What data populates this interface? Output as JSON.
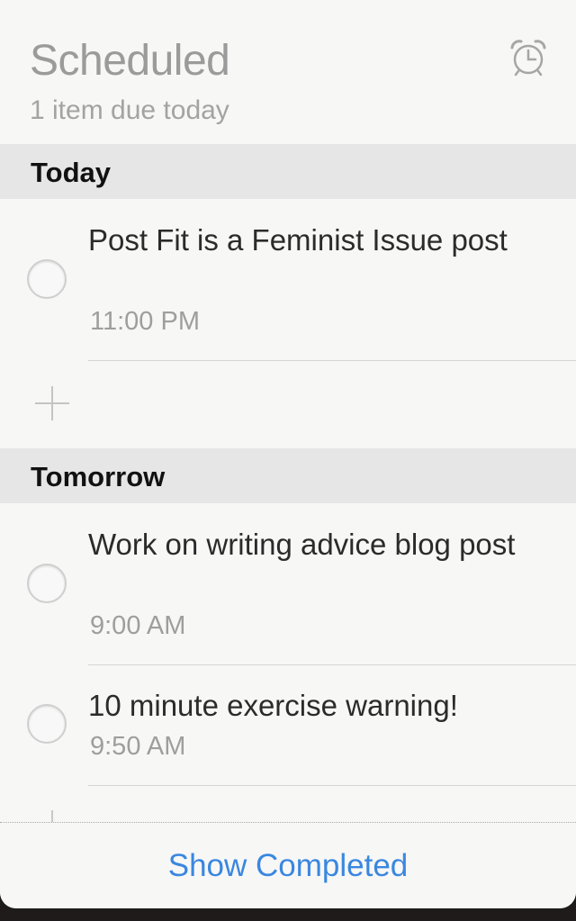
{
  "header": {
    "title": "Scheduled",
    "subtitle": "1 item due today",
    "alarm_icon": "alarm-clock-icon"
  },
  "sections": [
    {
      "label": "Today",
      "tasks": [
        {
          "title": "Post Fit is a Feminist Issue post",
          "time": "11:00 PM",
          "completed": false
        }
      ]
    },
    {
      "label": "Tomorrow",
      "tasks": [
        {
          "title": "Work on writing advice blog post",
          "time": "9:00 AM",
          "completed": false
        },
        {
          "title": "10 minute exercise warning!",
          "time": "9:50 AM",
          "completed": false
        }
      ]
    }
  ],
  "footer": {
    "show_completed_label": "Show Completed"
  },
  "colors": {
    "accent": "#3a87e0",
    "section_bg": "#e6e6e6",
    "background": "#f7f7f6"
  }
}
